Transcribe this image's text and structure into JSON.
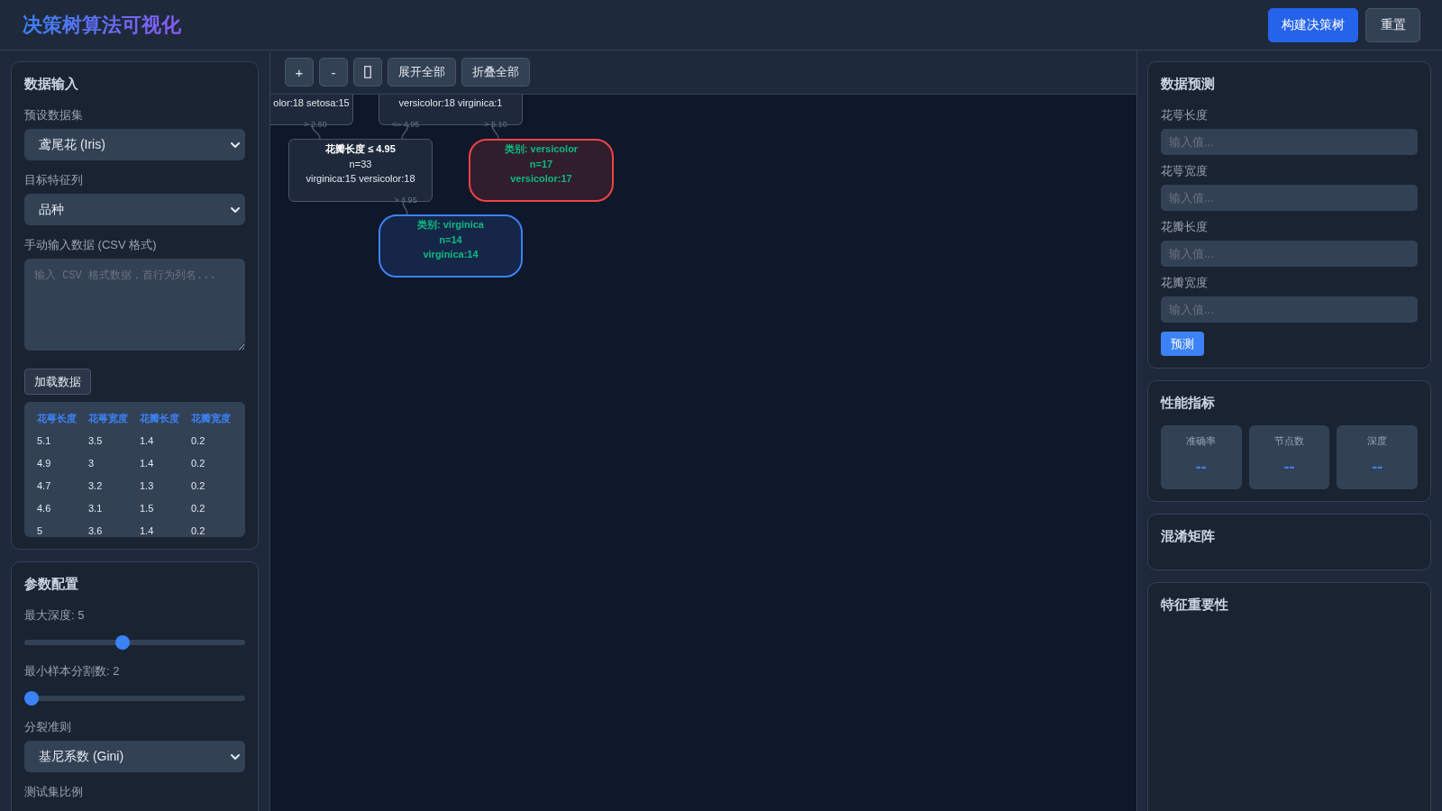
{
  "header": {
    "title": "决策树算法可视化",
    "buttons": [
      {
        "label": "构建决策树",
        "kind": "primary"
      },
      {
        "label": "重置",
        "kind": "secondary"
      }
    ]
  },
  "data_input": {
    "title": "数据输入",
    "preset": {
      "label": "预设数据集",
      "value": "鸢尾花 (Iris)"
    },
    "target": {
      "label": "目标特征列",
      "value": "品种"
    },
    "manual": {
      "label": "手动输入数据 (CSV 格式)",
      "placeholder": "输入 CSV 格式数据，首行为列名..."
    },
    "load_button": "加载数据",
    "table": {
      "columns": [
        "花萼长度",
        "花萼宽度",
        "花瓣长度",
        "花瓣宽度"
      ],
      "rows": [
        [
          "5.1",
          "3.5",
          "1.4",
          "0.2"
        ],
        [
          "4.9",
          "3",
          "1.4",
          "0.2"
        ],
        [
          "4.7",
          "3.2",
          "1.3",
          "0.2"
        ],
        [
          "4.6",
          "3.1",
          "1.5",
          "0.2"
        ],
        [
          "5",
          "3.6",
          "1.4",
          "0.2"
        ]
      ]
    }
  },
  "params": {
    "title": "参数配置",
    "items": [
      {
        "kind": "slider",
        "label": "最大深度: 5",
        "level": 0.44
      },
      {
        "kind": "slider",
        "label": "最小样本分割数: 2",
        "level": 0
      },
      {
        "kind": "select",
        "label": "分裂准则",
        "value": "基尼系数 (Gini)"
      },
      {
        "kind": "label",
        "label": "测试集比例"
      }
    ]
  },
  "toolbar": {
    "buttons": [
      {
        "kind": "text",
        "label": "+"
      },
      {
        "kind": "text",
        "label": "-"
      },
      {
        "kind": "icon"
      },
      {
        "kind": "text",
        "label": "展开全部"
      },
      {
        "kind": "text",
        "label": "折叠全部"
      }
    ]
  },
  "tree": {
    "nodes": [
      {
        "kind": "partial",
        "counts": "olor:18 setosa:15",
        "color": "#475569"
      },
      {
        "kind": "partial",
        "counts": "versicolor:18 virginica:1",
        "color": "#475569"
      },
      {
        "kind": "split",
        "title": "花瓣长度 ≤ 4.95",
        "samples": "n=33",
        "counts": "virginica:15 versicolor:18",
        "color": "#475569"
      },
      {
        "kind": "leaf",
        "title": "类别: versicolor",
        "samples": "n=17",
        "counts": "versicolor:17",
        "color": "#ef4444"
      },
      {
        "kind": "leaf",
        "title": "类别: virginica",
        "samples": "n=14",
        "counts": "virginica:14",
        "color": "#3b82f6"
      }
    ],
    "edges": [
      {
        "label": "> 2.60"
      },
      {
        "label": "<= 4.95"
      },
      {
        "label": "> 5.10"
      },
      {
        "label": "> 4.95"
      }
    ]
  },
  "prediction": {
    "title": "数据预测",
    "fields": [
      {
        "label": "花萼长度",
        "placeholder": "输入值..."
      },
      {
        "label": "花萼宽度",
        "placeholder": "输入值..."
      },
      {
        "label": "花瓣长度",
        "placeholder": "输入值..."
      },
      {
        "label": "花瓣宽度",
        "placeholder": "输入值..."
      }
    ],
    "button": "预测"
  },
  "metrics": {
    "title": "性能指标",
    "items": [
      {
        "label": "准确率",
        "value": "--"
      },
      {
        "label": "节点数",
        "value": "--"
      },
      {
        "label": "深度",
        "value": "--"
      }
    ]
  },
  "confusion_matrix": {
    "title": "混淆矩阵"
  },
  "feature_importance": {
    "title": "特征重要性"
  }
}
